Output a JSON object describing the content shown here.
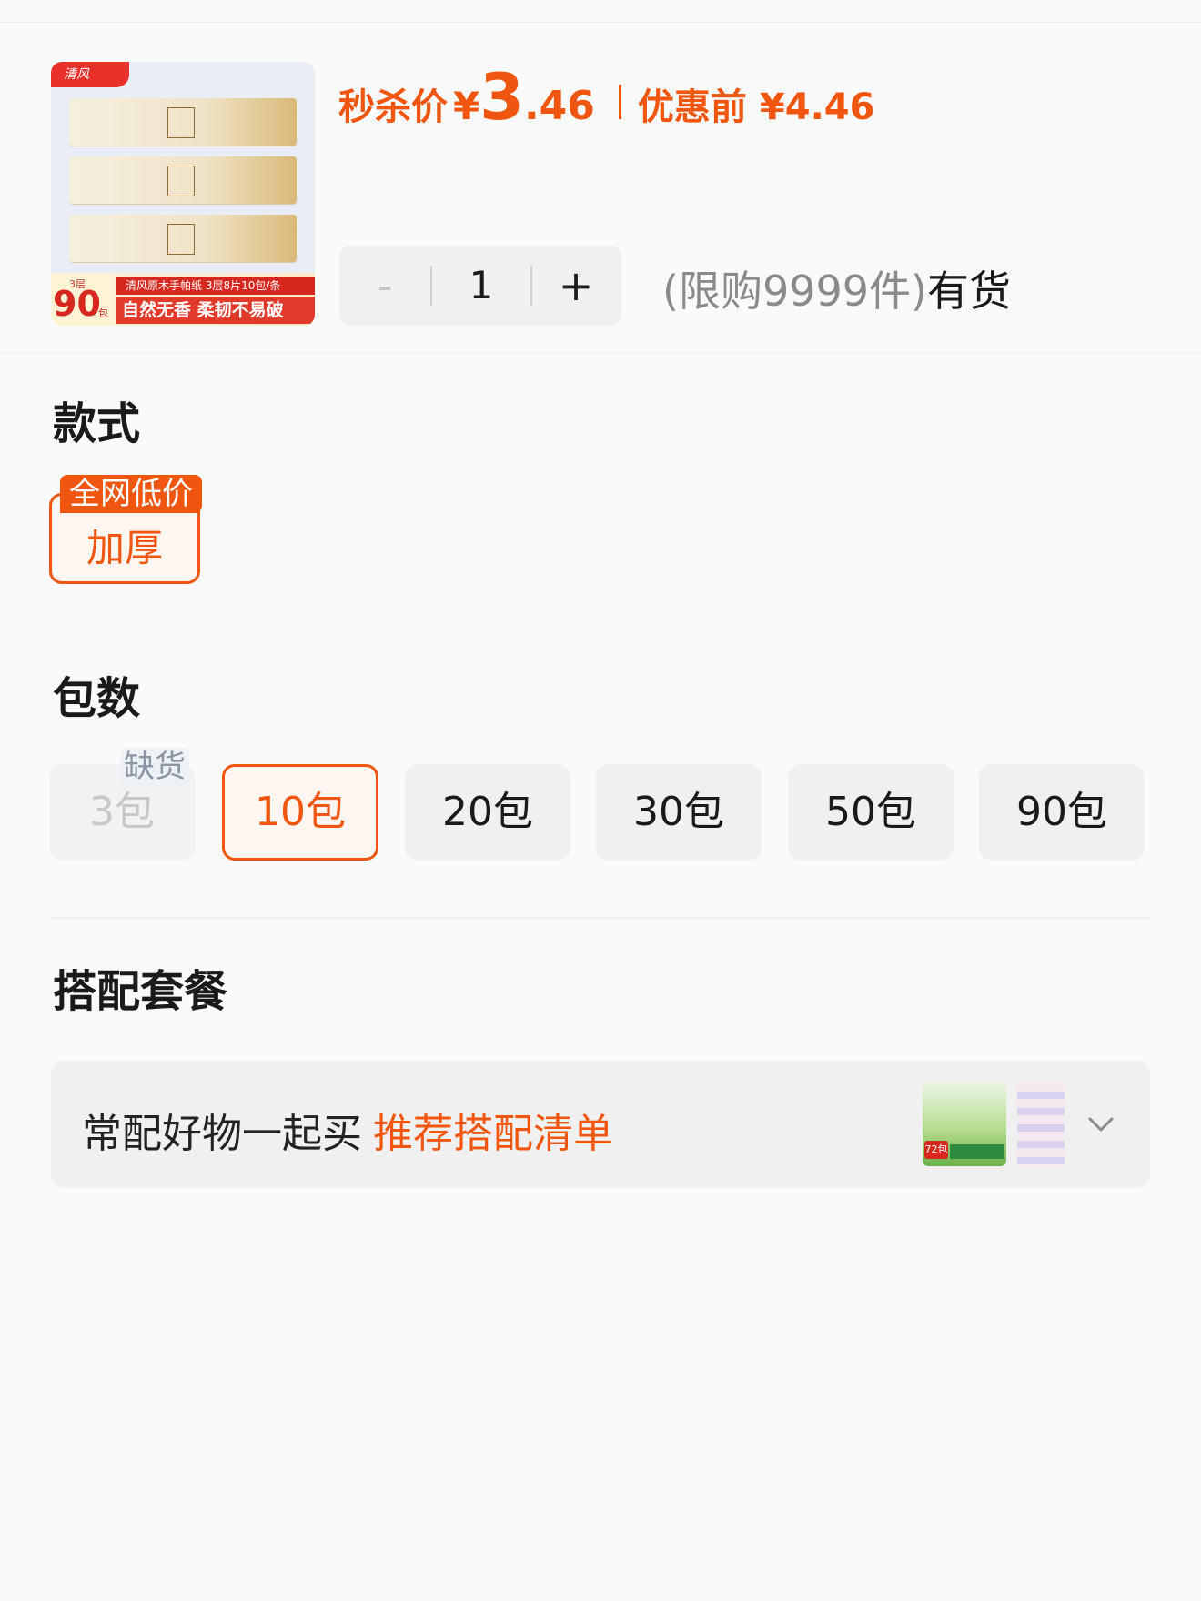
{
  "product": {
    "thumbnail": {
      "brand": "清风",
      "layers_note": "3层",
      "count": "90",
      "count_unit": "包",
      "line1": "清风原木手帕纸 3层8片10包/条",
      "line2": "自然无香 柔韧不易破"
    },
    "price": {
      "flash_label": "秒杀价",
      "currency": "¥",
      "flash_int": "3",
      "flash_dec": ".46",
      "original_label": "优惠前",
      "original_price": "¥4.46"
    },
    "stepper": {
      "minus": "-",
      "quantity": "1",
      "plus": "+"
    },
    "stock": {
      "limit": "(限购9999件)",
      "status": "有货"
    }
  },
  "style_section": {
    "title": "款式",
    "options": [
      {
        "label": "加厚",
        "tag": "全网低价",
        "selected": true
      }
    ]
  },
  "pack_section": {
    "title": "包数",
    "options": [
      {
        "label": "3包",
        "state": "disabled",
        "tag": "缺货"
      },
      {
        "label": "10包",
        "state": "selected"
      },
      {
        "label": "20包",
        "state": "normal"
      },
      {
        "label": "30包",
        "state": "normal"
      },
      {
        "label": "50包",
        "state": "normal"
      },
      {
        "label": "90包",
        "state": "normal"
      }
    ]
  },
  "combo_section": {
    "title": "搭配套餐",
    "prefix": "常配好物一起买",
    "link": "推荐搭配清单",
    "thumb_badge": "72包",
    "expand_icon": "chevron-down-icon"
  },
  "colors": {
    "accent": "#f0560f",
    "background": "#fafafa",
    "chip": "#f0f0f0"
  }
}
